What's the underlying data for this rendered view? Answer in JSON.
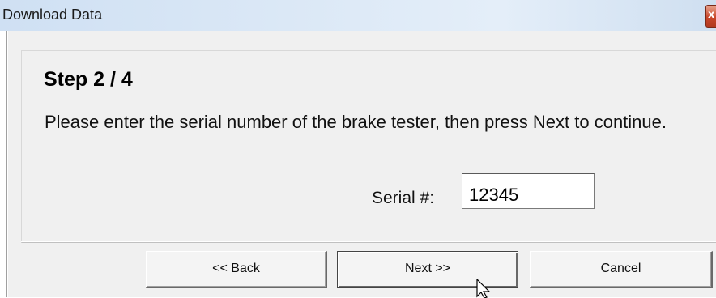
{
  "window": {
    "title": "Download Data",
    "close_glyph": "x"
  },
  "wizard": {
    "step_title": "Step 2 / 4",
    "instruction": "Please enter the serial number of the brake tester, then press Next to continue.",
    "serial_label": "Serial #:",
    "serial_value": "12345"
  },
  "buttons": {
    "back": "<< Back",
    "next": "Next >>",
    "cancel": "Cancel"
  },
  "icons": {
    "close": "close-icon",
    "cursor": "mouse-cursor-icon"
  }
}
